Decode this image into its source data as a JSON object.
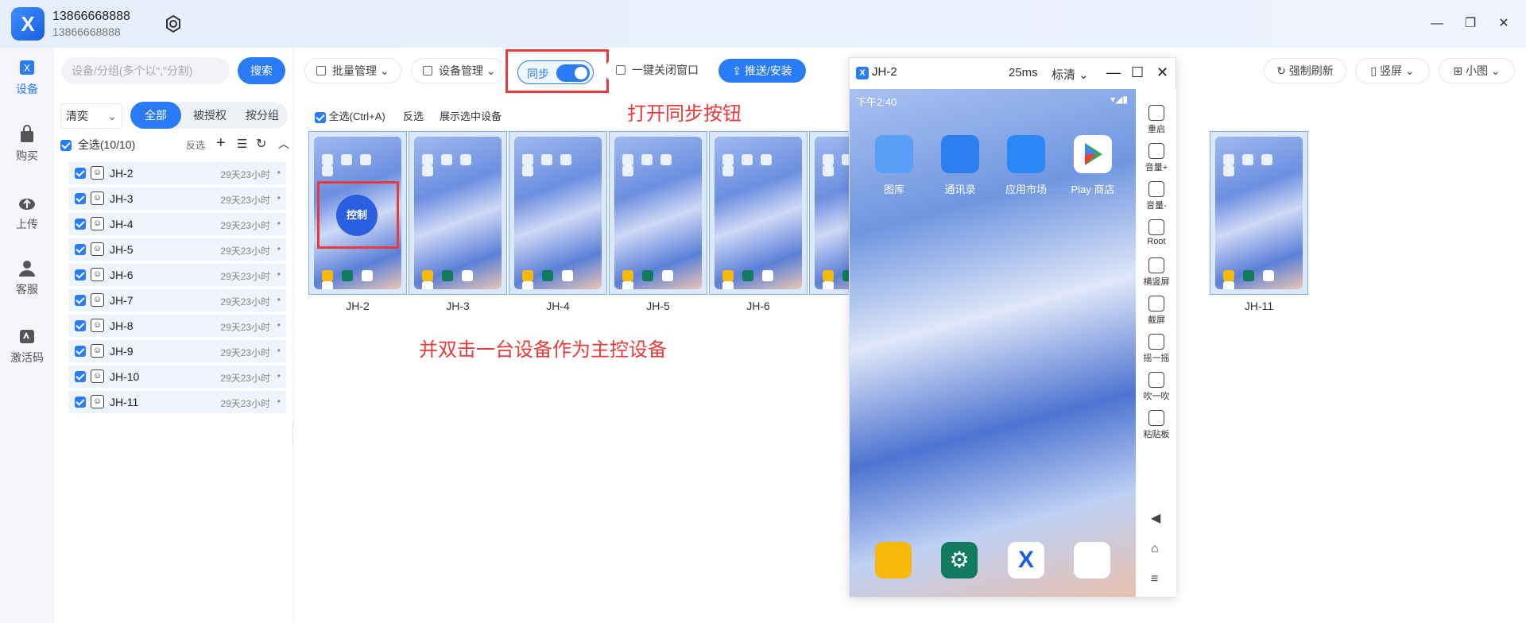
{
  "account": {
    "name": "13866668888",
    "id": "13866668888"
  },
  "window_controls": {
    "minimize": "—",
    "restore": "❐",
    "close": "✕"
  },
  "nav": [
    {
      "label": "设备",
      "icon": "device-icon",
      "active": true
    },
    {
      "label": "购买",
      "icon": "shopping-bag-icon"
    },
    {
      "label": "上传",
      "icon": "cloud-upload-icon"
    },
    {
      "label": "客服",
      "icon": "customer-service-icon"
    },
    {
      "label": "激活码",
      "icon": "activation-code-icon"
    }
  ],
  "left": {
    "search_placeholder": "设备/分组(多个以“,”分割)",
    "search_button": "搜索",
    "filter_select": "清奕",
    "segments": [
      "全部",
      "被授权",
      "按分组"
    ],
    "select_all": "全选(10/10)",
    "invert": "反选",
    "devices": [
      {
        "name": "JH-2",
        "time": "29天23小时"
      },
      {
        "name": "JH-3",
        "time": "29天23小时"
      },
      {
        "name": "JH-4",
        "time": "29天23小时"
      },
      {
        "name": "JH-5",
        "time": "29天23小时"
      },
      {
        "name": "JH-6",
        "time": "29天23小时"
      },
      {
        "name": "JH-7",
        "time": "29天23小时"
      },
      {
        "name": "JH-8",
        "time": "29天23小时"
      },
      {
        "name": "JH-9",
        "time": "29天23小时"
      },
      {
        "name": "JH-10",
        "time": "29天23小时"
      },
      {
        "name": "JH-11",
        "time": "29天23小时"
      }
    ]
  },
  "toolbar": {
    "batch": "批量管理",
    "device_mgmt": "设备管理",
    "sync": "同步",
    "close_all": "一键关闭窗口",
    "push": "推送/安装",
    "refresh": "强制刷新",
    "orientation": "竖屏",
    "view": "小图"
  },
  "subbar": {
    "select_all": "全选(Ctrl+A)",
    "invert": "反选",
    "show_selected": "展示选中设备"
  },
  "annotations": {
    "sync_tip": "打开同步按钮",
    "double_click_tip": "并双击一台设备作为主控设备",
    "control": "控制"
  },
  "thumbs": [
    "JH-2",
    "JH-3",
    "JH-4",
    "JH-5",
    "JH-6",
    "J",
    "JH-11"
  ],
  "popup": {
    "title": "JH-2",
    "latency": "25ms",
    "quality": "标清",
    "status_time": "下午2:40",
    "apps": [
      "图库",
      "通讯录",
      "应用市场",
      "Play 商店"
    ],
    "side": [
      "重启",
      "音量+",
      "音量-",
      "Root",
      "横竖屏",
      "截屏",
      "摇一摇",
      "吹一吹",
      "粘贴板"
    ]
  }
}
